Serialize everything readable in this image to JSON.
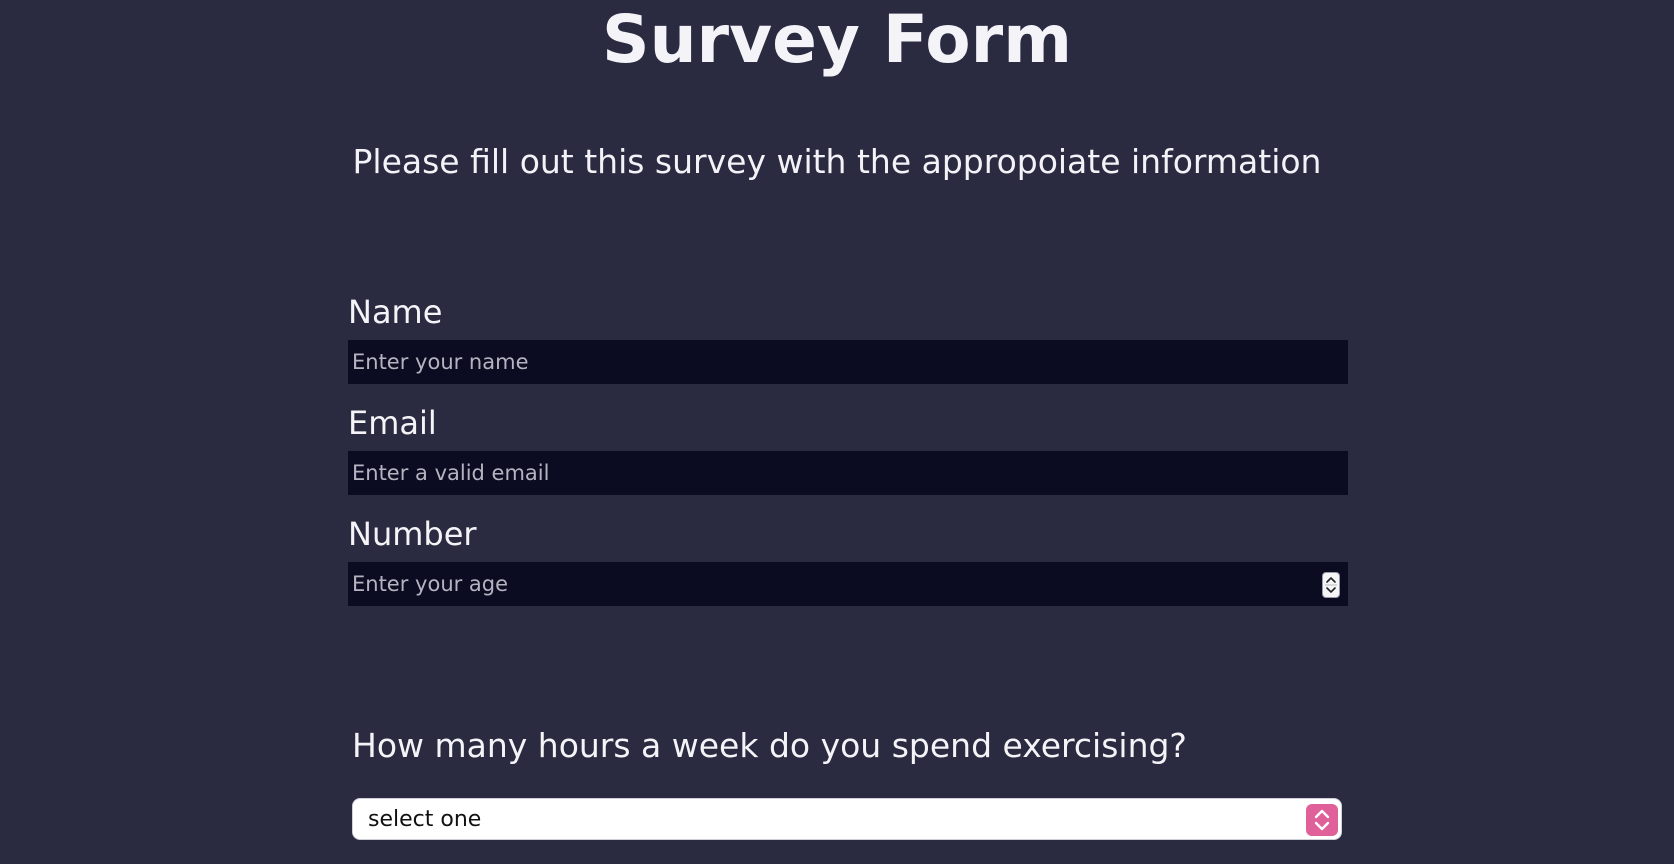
{
  "header": {
    "title": "Survey Form",
    "description": "Please fill out this survey with the appropoiate information"
  },
  "form": {
    "name": {
      "label": "Name",
      "placeholder": "Enter your name",
      "value": ""
    },
    "email": {
      "label": "Email",
      "placeholder": "Enter a valid email",
      "value": ""
    },
    "number": {
      "label": "Number",
      "placeholder": "Enter your age",
      "value": "",
      "icon": "spinner-arrows-icon"
    },
    "exercise": {
      "question": "How many hours a week do you spend exercising?",
      "selected": "select one",
      "icon": "chevron-up-down-icon"
    }
  },
  "colors": {
    "background": "#2a2a40",
    "input_background": "#0b0b22",
    "text": "#f3f3f8",
    "placeholder": "#b4b4c0",
    "select_accent": "#e0609a"
  }
}
